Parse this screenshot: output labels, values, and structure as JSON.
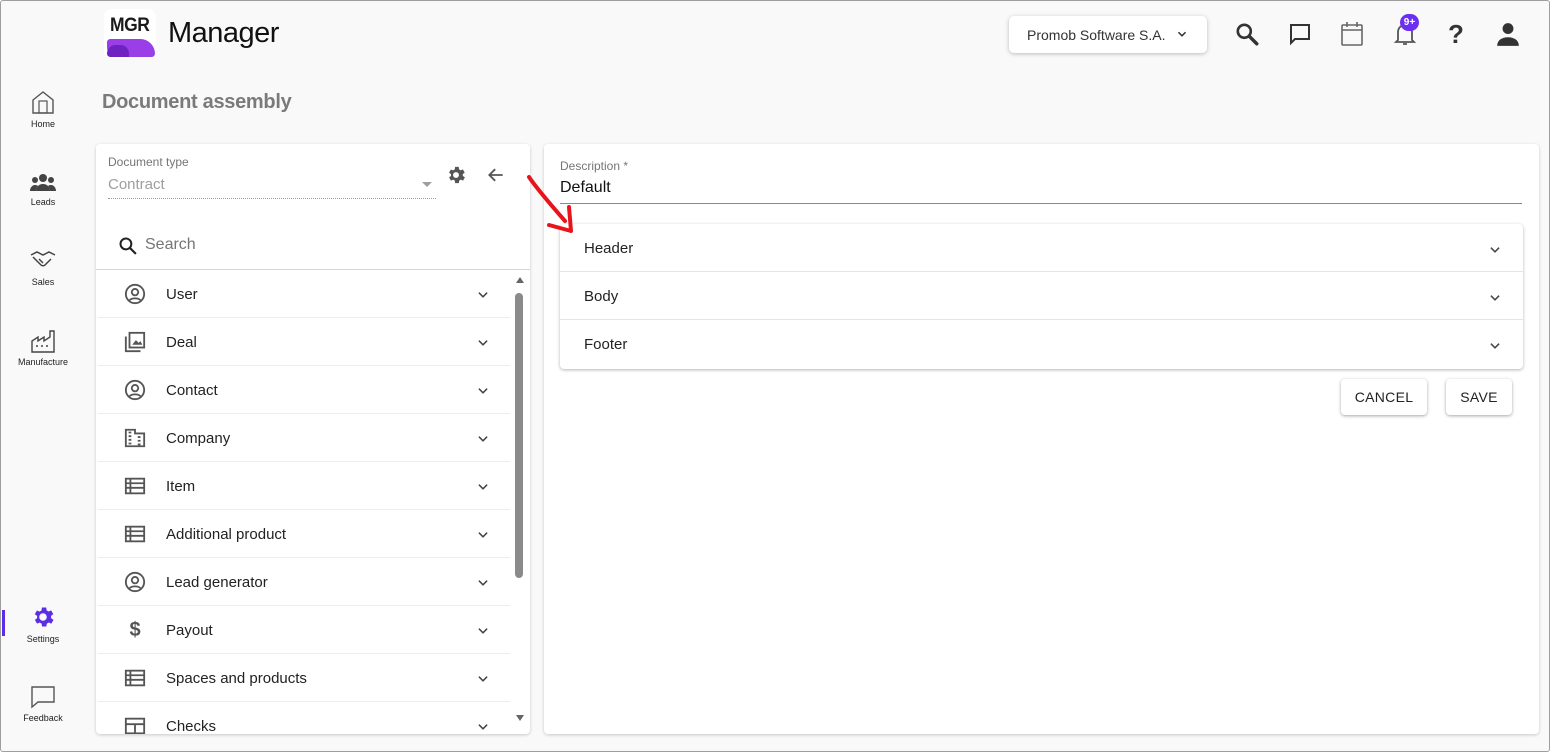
{
  "app": {
    "logo_text": "MGR",
    "title": "Manager"
  },
  "header": {
    "company": "Promob Software S.A.",
    "notification_badge": "9+",
    "icons": [
      "search-icon",
      "chat-icon",
      "calendar-icon",
      "bell-icon",
      "help-icon",
      "account-icon"
    ]
  },
  "sidebar": {
    "items": [
      {
        "label": "Home",
        "icon": "home-icon"
      },
      {
        "label": "Leads",
        "icon": "people-icon"
      },
      {
        "label": "Sales",
        "icon": "handshake-icon"
      },
      {
        "label": "Manufacture",
        "icon": "factory-icon"
      },
      {
        "label": "Settings",
        "icon": "gear-icon",
        "active": true
      },
      {
        "label": "Feedback",
        "icon": "feedback-icon"
      }
    ],
    "accent": "#5b2ee6"
  },
  "page": {
    "title": "Document assembly"
  },
  "left_panel": {
    "doc_type_label": "Document type",
    "doc_type_value": "Contract",
    "search_placeholder": "Search",
    "items": [
      {
        "label": "User",
        "icon": "user-circle-icon"
      },
      {
        "label": "Deal",
        "icon": "gallery-icon"
      },
      {
        "label": "Contact",
        "icon": "user-circle-icon"
      },
      {
        "label": "Company",
        "icon": "building-icon"
      },
      {
        "label": "Item",
        "icon": "list-icon"
      },
      {
        "label": "Additional product",
        "icon": "list-icon"
      },
      {
        "label": "Lead generator",
        "icon": "user-circle-icon"
      },
      {
        "label": "Payout",
        "icon": "dollar-icon"
      },
      {
        "label": "Spaces and products",
        "icon": "list-icon"
      },
      {
        "label": "Checks",
        "icon": "table-icon"
      }
    ]
  },
  "right_panel": {
    "description_label": "Description *",
    "description_value": "Default",
    "sections": [
      {
        "label": "Header"
      },
      {
        "label": "Body"
      },
      {
        "label": "Footer"
      }
    ],
    "cancel_label": "CANCEL",
    "save_label": "SAVE"
  },
  "colors": {
    "brand_purple": "#9a3ee8",
    "badge": "#6c2ff2",
    "annotation_arrow": "#e8141c"
  }
}
